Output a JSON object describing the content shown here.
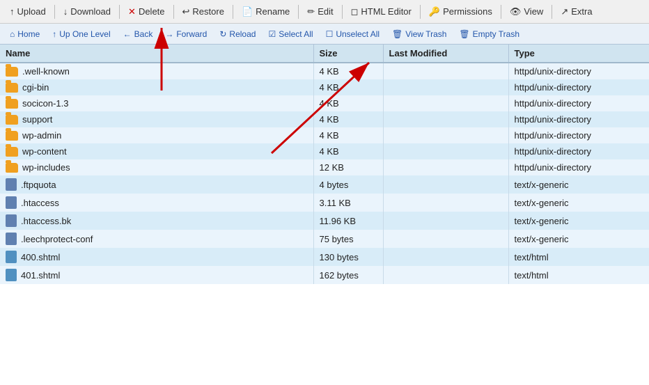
{
  "toolbar": {
    "buttons": [
      {
        "id": "upload",
        "label": "Upload",
        "icon": "↑"
      },
      {
        "id": "download",
        "label": "Download",
        "icon": "↓"
      },
      {
        "id": "delete",
        "label": "Delete",
        "icon": "✕"
      },
      {
        "id": "restore",
        "label": "Restore",
        "icon": "↩"
      },
      {
        "id": "rename",
        "label": "Rename",
        "icon": "📄"
      },
      {
        "id": "edit",
        "label": "Edit",
        "icon": "✏"
      },
      {
        "id": "html-editor",
        "label": "HTML Editor",
        "icon": "<>"
      },
      {
        "id": "permissions",
        "label": "Permissions",
        "icon": "🔑"
      },
      {
        "id": "view",
        "label": "View",
        "icon": "👁"
      },
      {
        "id": "extra",
        "label": "Extra",
        "icon": "↗"
      }
    ]
  },
  "navbar": {
    "buttons": [
      {
        "id": "home",
        "label": "Home",
        "icon": "⌂"
      },
      {
        "id": "up-one-level",
        "label": "Up One Level",
        "icon": "↑"
      },
      {
        "id": "back",
        "label": "Back",
        "icon": "←"
      },
      {
        "id": "forward",
        "label": "Forward",
        "icon": "→"
      },
      {
        "id": "reload",
        "label": "Reload",
        "icon": "↻"
      },
      {
        "id": "select-all",
        "label": "Select All",
        "icon": "☑"
      },
      {
        "id": "unselect-all",
        "label": "Unselect All",
        "icon": "☐"
      },
      {
        "id": "view-trash",
        "label": "View Trash",
        "icon": "🗑"
      },
      {
        "id": "empty-trash",
        "label": "Empty Trash",
        "icon": "🗑"
      }
    ]
  },
  "table": {
    "columns": [
      "Name",
      "Size",
      "Last Modified",
      "Type"
    ],
    "rows": [
      {
        "icon": "folder",
        "name": ".well-known",
        "size": "4 KB",
        "modified": "",
        "type": "httpd/unix-directory"
      },
      {
        "icon": "folder",
        "name": "cgi-bin",
        "size": "4 KB",
        "modified": "",
        "type": "httpd/unix-directory"
      },
      {
        "icon": "folder",
        "name": "socicon-1.3",
        "size": "4 KB",
        "modified": "",
        "type": "httpd/unix-directory"
      },
      {
        "icon": "folder",
        "name": "support",
        "size": "4 KB",
        "modified": "",
        "type": "httpd/unix-directory"
      },
      {
        "icon": "folder",
        "name": "wp-admin",
        "size": "4 KB",
        "modified": "",
        "type": "httpd/unix-directory"
      },
      {
        "icon": "folder",
        "name": "wp-content",
        "size": "4 KB",
        "modified": "",
        "type": "httpd/unix-directory"
      },
      {
        "icon": "folder",
        "name": "wp-includes",
        "size": "12 KB",
        "modified": "",
        "type": "httpd/unix-directory"
      },
      {
        "icon": "text",
        "name": ".ftpquota",
        "size": "4 bytes",
        "modified": "",
        "type": "text/x-generic"
      },
      {
        "icon": "text",
        "name": ".htaccess",
        "size": "3.11 KB",
        "modified": "",
        "type": "text/x-generic"
      },
      {
        "icon": "text",
        "name": ".htaccess.bk",
        "size": "11.96 KB",
        "modified": "",
        "type": "text/x-generic"
      },
      {
        "icon": "text",
        "name": ".leechprotect-conf",
        "size": "75 bytes",
        "modified": "",
        "type": "text/x-generic"
      },
      {
        "icon": "html",
        "name": "400.shtml",
        "size": "130 bytes",
        "modified": "",
        "type": "text/html"
      },
      {
        "icon": "html",
        "name": "401.shtml",
        "size": "162 bytes",
        "modified": "",
        "type": "text/html"
      }
    ]
  },
  "colors": {
    "folder": "#f0a020",
    "text_file": "#6080b0",
    "html_file": "#5090c0",
    "accent": "#2255aa"
  }
}
